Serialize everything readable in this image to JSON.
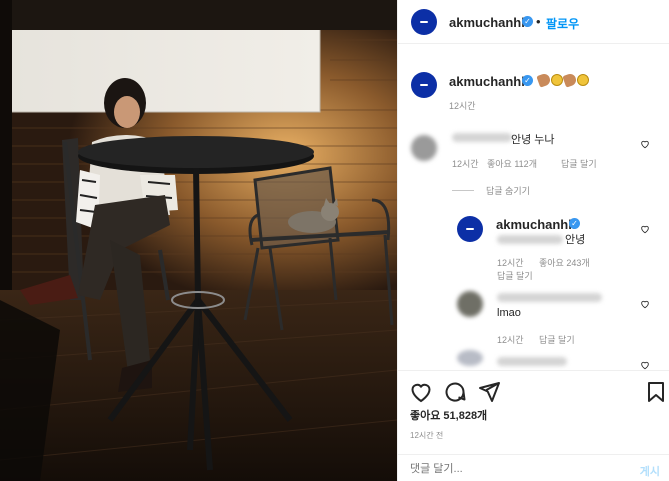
{
  "post": {
    "username": "akmuchanhk",
    "follow_label": "팔로우",
    "separator": "•",
    "caption_time": "12시간",
    "caption_emoji": [
      "peach-emoji",
      "sun-emoji",
      "peach-emoji",
      "sun-emoji"
    ]
  },
  "comments": [
    {
      "text": "안녕 누나",
      "time": "12시간",
      "likes": "좋아요 112개",
      "reply": "답글 달기",
      "hide_replies": "답글 숨기기"
    },
    {
      "username": "akmuchanhk",
      "text": "안녕",
      "time": "12시간",
      "likes": "좋아요 243개",
      "reply": "답글 달기"
    },
    {
      "text": "lmao",
      "time": "12시간",
      "reply": "답글 달기"
    }
  ],
  "actions": {
    "likes": "좋아요 51,828개",
    "time": "12시간 전",
    "comment_placeholder": "댓글 달기...",
    "post_label": "게시"
  },
  "colors": {
    "accent": "#0095f6",
    "verified": "#3897f0",
    "avatar": "#0c2fa6",
    "muted": "#8e8e8e"
  },
  "icons": [
    "heart-icon",
    "comment-icon",
    "share-icon",
    "bookmark-icon",
    "verified-icon"
  ]
}
